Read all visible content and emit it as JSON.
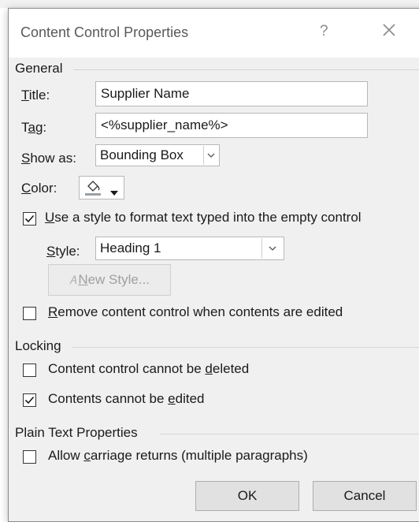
{
  "dialog": {
    "title": "Content Control Properties",
    "help": "?"
  },
  "general": {
    "heading": "General",
    "title_label_mnemonic": "T",
    "title_label_rest": "itle:",
    "title_value": "Supplier Name",
    "tag_label_pre": "T",
    "tag_label_mnemonic": "a",
    "tag_label_rest": "g:",
    "tag_value": "<%supplier_name%>",
    "showas_label_mnemonic": "S",
    "showas_label_rest": "how as:",
    "showas_value": "Bounding Box",
    "color_label_mnemonic": "C",
    "color_label_rest": "olor:",
    "use_style_mnemonic": "U",
    "use_style_rest": "se a style to format text typed into the empty control",
    "use_style_checked": true,
    "style_label_mnemonic": "S",
    "style_label_rest": "tyle:",
    "style_value": "Heading 1",
    "new_style_mnemonic": "N",
    "new_style_rest": "ew Style...",
    "remove_mnemonic": "R",
    "remove_rest": "emove content control when contents are edited",
    "remove_checked": false
  },
  "locking": {
    "heading": "Locking",
    "cannot_delete_pre": "Content control cannot be ",
    "cannot_delete_mnemonic": "d",
    "cannot_delete_rest": "eleted",
    "cannot_delete_checked": false,
    "cannot_edit_pre": "Contents cannot be ",
    "cannot_edit_mnemonic": "e",
    "cannot_edit_rest": "dited",
    "cannot_edit_checked": true
  },
  "plain_text": {
    "heading": "Plain Text Properties",
    "carriage_pre": "Allow ",
    "carriage_mnemonic": "c",
    "carriage_rest": "arriage returns (multiple paragraphs)",
    "carriage_checked": false
  },
  "buttons": {
    "ok": "OK",
    "cancel": "Cancel"
  },
  "colors": {
    "dialog_bg": "#f0f0f0",
    "titlebar_bg": "#ffffff",
    "button_bg": "#e1e1e1",
    "disabled_text": "#a0a0a0"
  }
}
